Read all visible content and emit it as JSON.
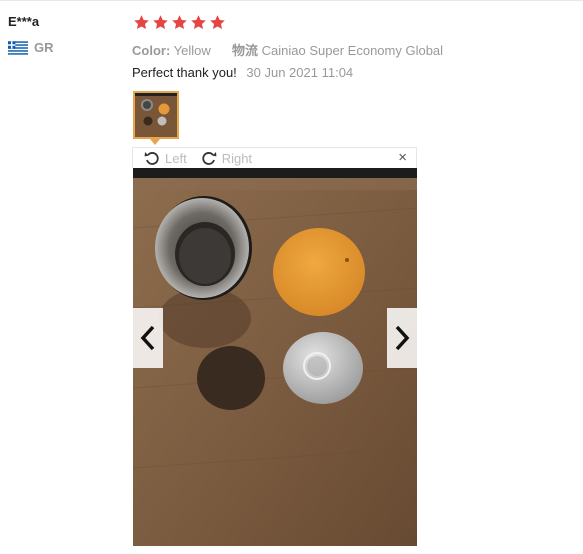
{
  "reviewer": {
    "name": "E***a",
    "country": "GR",
    "flag_icon": "greece-flag-icon"
  },
  "rating": {
    "stars": 5,
    "max": 5,
    "color": "#e64545"
  },
  "meta": {
    "color_label": "Color:",
    "color_value": "Yellow",
    "shipping_label": "物流",
    "shipping_value": "Cainiao Super Economy Global"
  },
  "review": {
    "text": "Perfect thank you!",
    "date": "30 Jun 2021 11:04"
  },
  "viewer": {
    "rotate_left_label": "Left",
    "rotate_right_label": "Right",
    "close_label": "×",
    "prev_icon": "chevron-left-icon",
    "next_icon": "chevron-right-icon"
  },
  "colors": {
    "accent": "#e8a54b",
    "muted": "#999999"
  }
}
